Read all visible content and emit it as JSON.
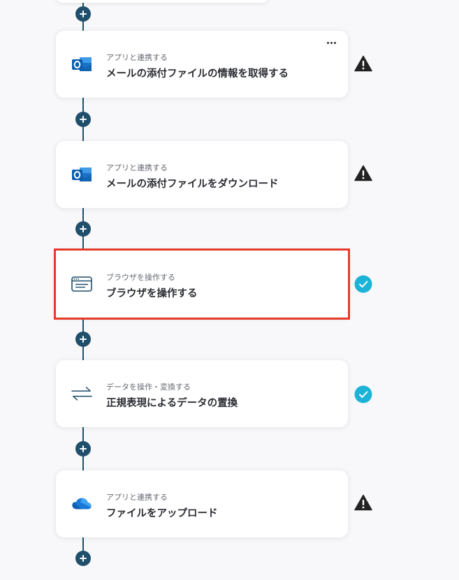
{
  "flow": {
    "steps": [
      {
        "category": "アプリと連携する",
        "title": "メールの添付ファイルの情報を取得する",
        "icon": "outlook-icon",
        "status": "warning",
        "more_menu": "⋯"
      },
      {
        "category": "アプリと連携する",
        "title": "メールの添付ファイルをダウンロード",
        "icon": "outlook-icon",
        "status": "warning"
      },
      {
        "category": "ブラウザを操作する",
        "title": "ブラウザを操作する",
        "icon": "browser-window-icon",
        "status": "complete",
        "highlighted": true
      },
      {
        "category": "データを操作・変換する",
        "title": "正規表現によるデータの置換",
        "icon": "swap-arrows-icon",
        "status": "complete"
      },
      {
        "category": "アプリと連携する",
        "title": "ファイルをアップロード",
        "icon": "onedrive-icon",
        "status": "warning"
      }
    ]
  },
  "colors": {
    "line": "#1f4f6b",
    "highlight": "#e53a2b",
    "complete": "#1cb3d6",
    "warning": "#222222"
  }
}
